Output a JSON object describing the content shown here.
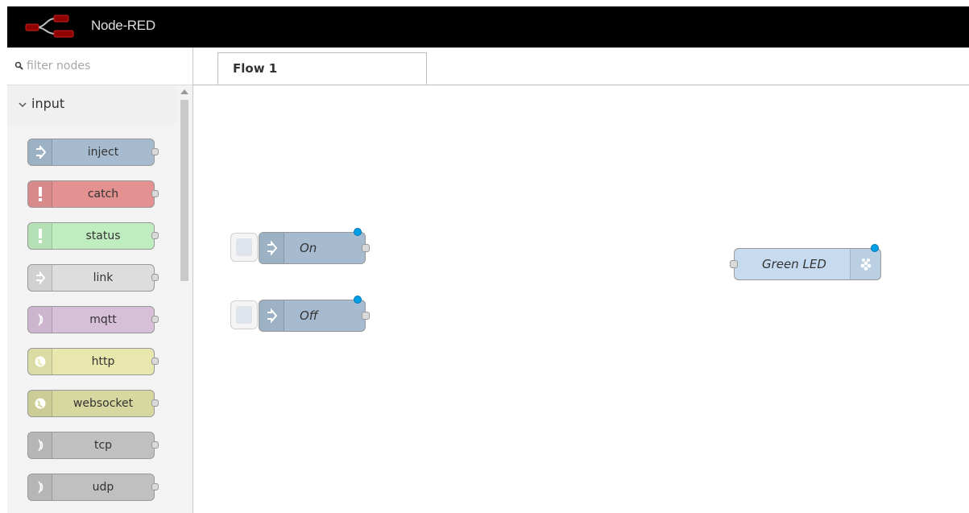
{
  "app": {
    "title": "Node-RED"
  },
  "palette": {
    "filter_placeholder": "filter nodes",
    "category": "input",
    "nodes": [
      {
        "label": "inject",
        "color": "#a6bbcf",
        "icon": "arrow-in-icon"
      },
      {
        "label": "catch",
        "color": "#e49191",
        "icon": "exclamation-icon"
      },
      {
        "label": "status",
        "color": "#c0edc0",
        "icon": "exclamation-icon"
      },
      {
        "label": "link",
        "color": "#dddddd",
        "icon": "link-icon"
      },
      {
        "label": "mqtt",
        "color": "#d8bfd8",
        "icon": "bridge-icon"
      },
      {
        "label": "http",
        "color": "#e7e7ae",
        "icon": "globe-icon"
      },
      {
        "label": "websocket",
        "color": "#d7d7a0",
        "icon": "globe-icon"
      },
      {
        "label": "tcp",
        "color": "#c0c0c0",
        "icon": "bridge-icon"
      },
      {
        "label": "udp",
        "color": "#c0c0c0",
        "icon": "bridge-icon"
      }
    ]
  },
  "workspace": {
    "tabs": [
      {
        "label": "Flow 1"
      }
    ],
    "nodes": [
      {
        "label": "On",
        "type": "inject",
        "color": "#a6bbcf"
      },
      {
        "label": "Off",
        "type": "inject",
        "color": "#a6bbcf"
      },
      {
        "label": "Green LED",
        "type": "rpi-gpio out",
        "color": "#c6dbef"
      }
    ]
  },
  "colors": {
    "header_bg": "#000000",
    "changed_dot": "#00a0e8"
  }
}
